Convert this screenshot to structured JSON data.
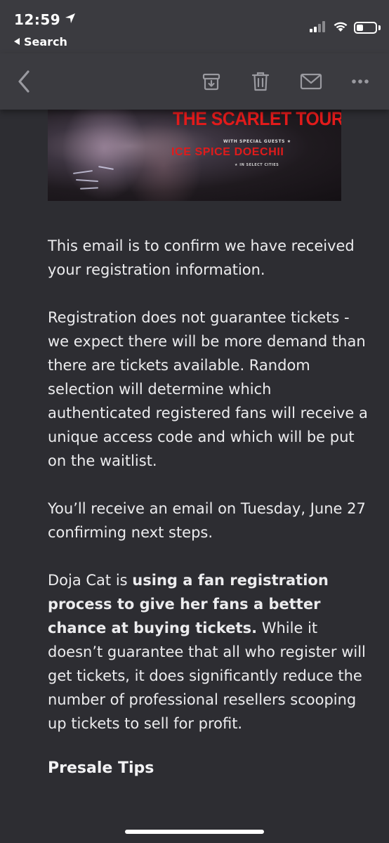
{
  "status": {
    "time": "12:59",
    "back_app": "Search"
  },
  "toolbar": {
    "back": "chevron-left-icon",
    "archive": "archive-icon",
    "trash": "trash-icon",
    "mail": "envelope-icon",
    "more": "more-icon"
  },
  "banner": {
    "title": "THE SCARLET TOUR",
    "guests_label": "WITH SPECIAL GUESTS ★",
    "artists": "ICE SPICE   DOECHII",
    "cities": "★ IN SELECT CITIES"
  },
  "email": {
    "p1": "This email is to confirm we have received your registration information.",
    "p2": "Registration does not guarantee tickets - we expect there will be more demand than there are tickets available. Random selection will determine which authenticated registered fans will receive a unique access code and which will be put on the waitlist.",
    "p3": "You’ll receive an email on Tuesday, June 27 confirming next steps.",
    "p4_prefix": "Doja Cat is ",
    "p4_bold": "using a fan registration process to give her fans a better chance at buying tickets.",
    "p4_rest": " While it doesn’t guarantee that all who register will get tickets, it does significantly reduce the number of professional resellers scooping up tickets to sell for profit.",
    "section_title": "Presale Tips"
  },
  "colors": {
    "background": "#2d2d32",
    "bar": "#3b3b40",
    "banner_red": "#e11b1b"
  }
}
